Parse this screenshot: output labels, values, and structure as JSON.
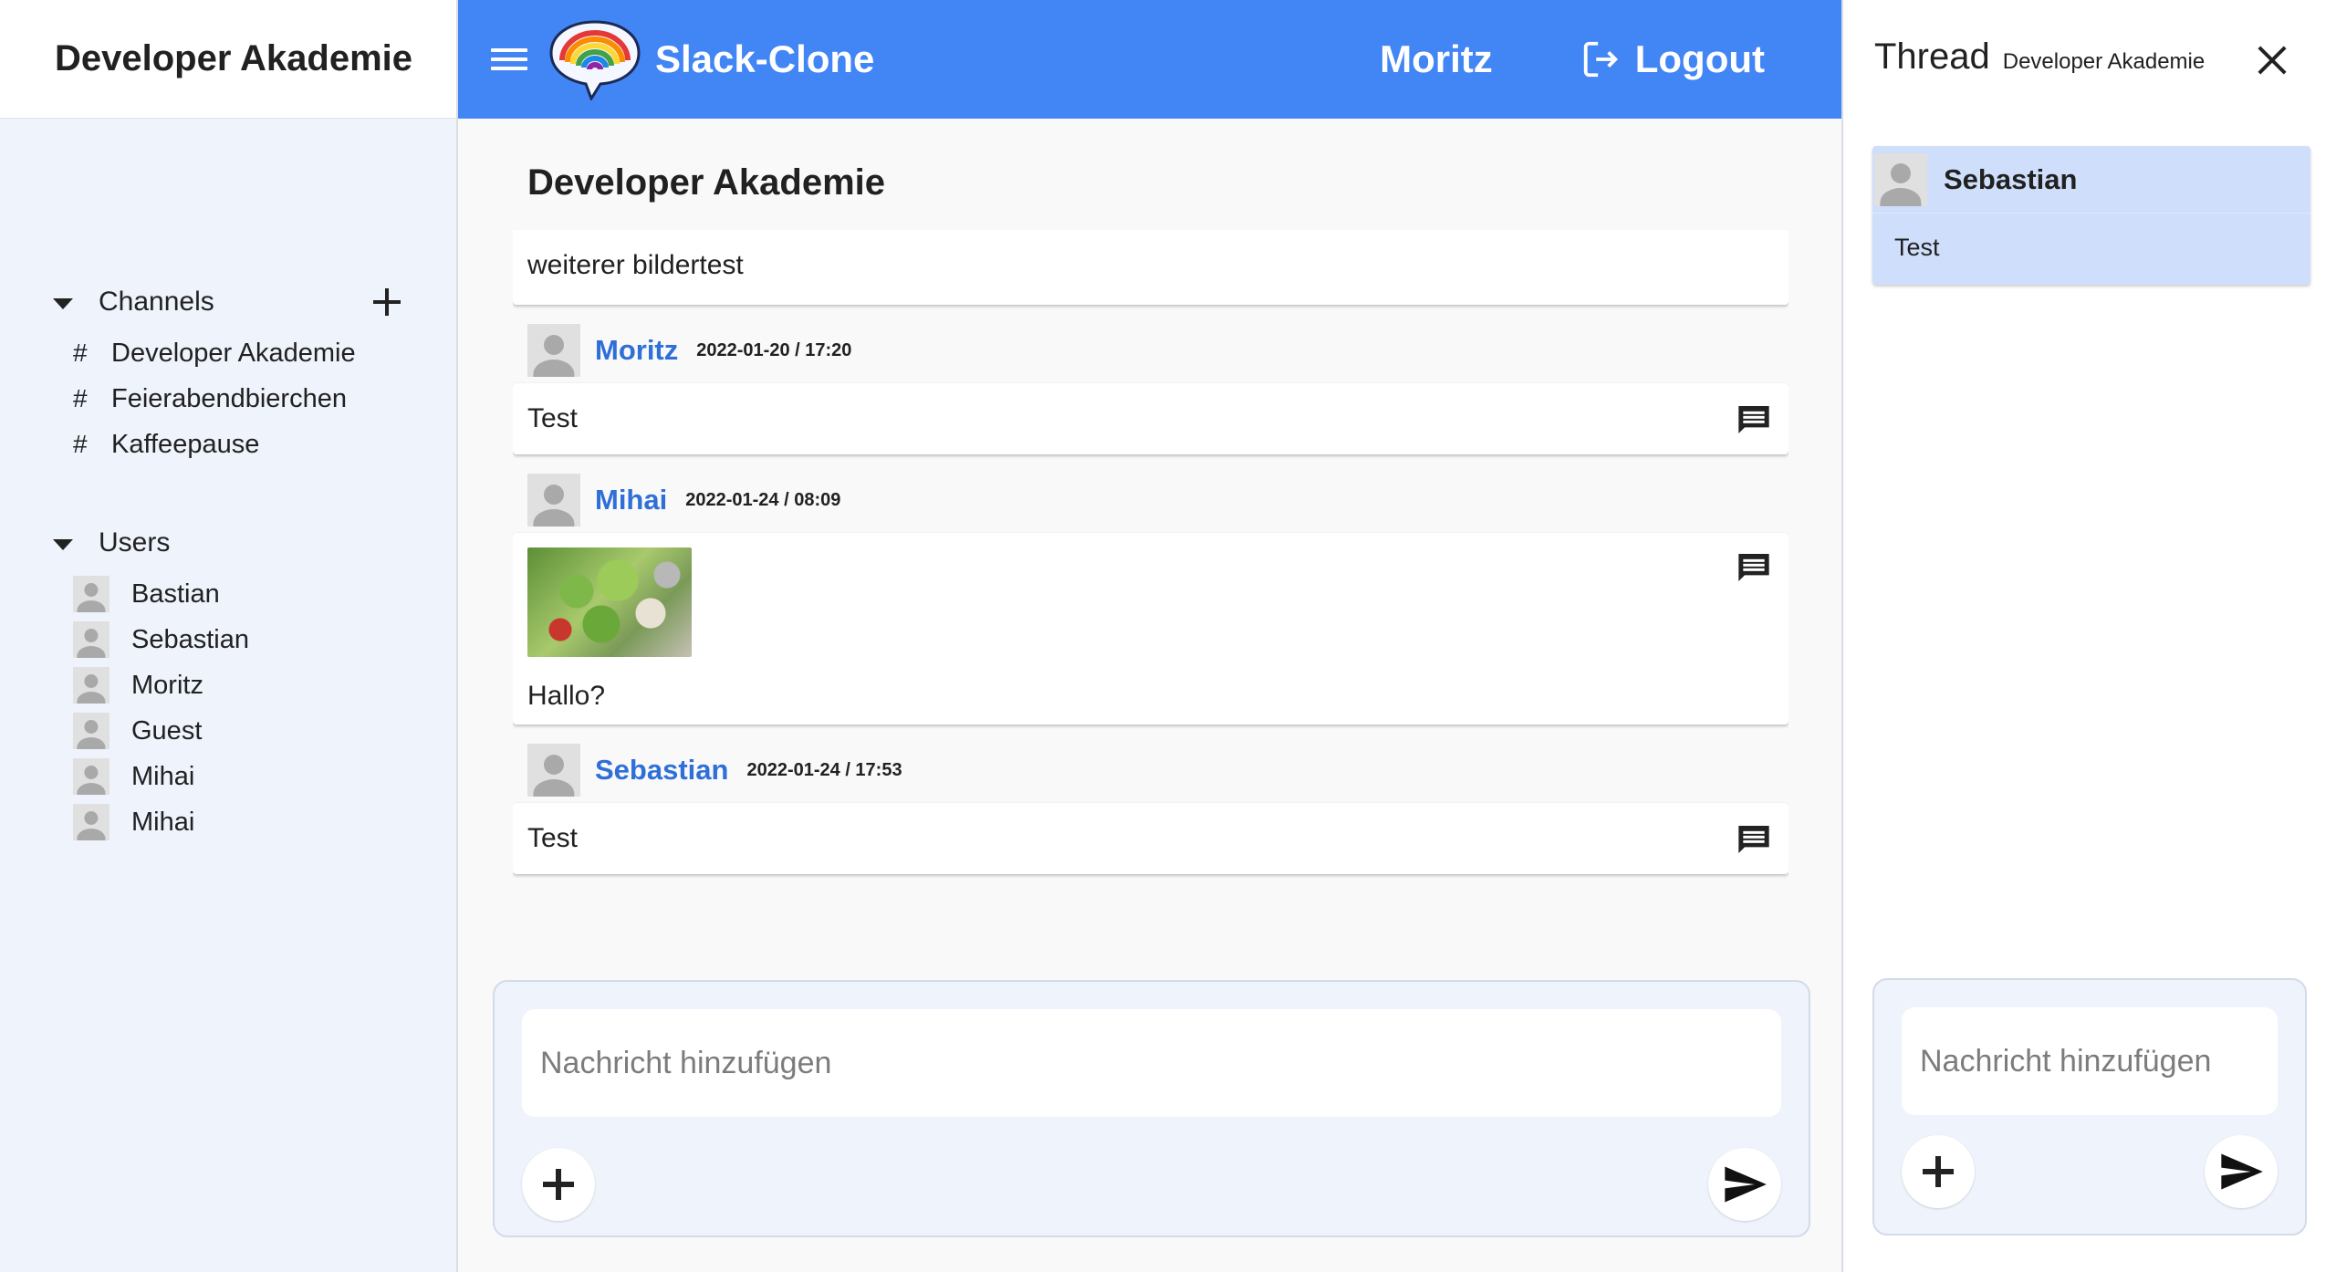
{
  "sidebar": {
    "workspace_title": "Developer Akademie",
    "channels_label": "Channels",
    "channels": [
      {
        "label": "Developer Akademie"
      },
      {
        "label": "Feierabendbierchen"
      },
      {
        "label": "Kaffeepause"
      }
    ],
    "users_label": "Users",
    "users": [
      {
        "name": "Bastian"
      },
      {
        "name": "Sebastian"
      },
      {
        "name": "Moritz"
      },
      {
        "name": "Guest"
      },
      {
        "name": "Mihai"
      },
      {
        "name": "Mihai"
      }
    ]
  },
  "topbar": {
    "app_title": "Slack-Clone",
    "current_user": "Moritz",
    "logout_label": "Logout",
    "accent_color": "#4285f4"
  },
  "main": {
    "channel_title": "Developer Akademie",
    "messages": [
      {
        "text": "weiterer bildertest"
      },
      {
        "author": "Moritz",
        "timestamp": "2022-01-20 / 17:20",
        "text": "Test"
      },
      {
        "author": "Mihai",
        "timestamp": "2022-01-24 / 08:09",
        "text": "Hallo?"
      },
      {
        "author": "Sebastian",
        "timestamp": "2022-01-24 / 17:53",
        "text": "Test"
      }
    ],
    "composer": {
      "placeholder": "Nachricht hinzufügen"
    }
  },
  "thread": {
    "title": "Thread",
    "channel": "Developer Akademie",
    "message": {
      "author": "Sebastian",
      "text": "Test"
    },
    "composer": {
      "placeholder": "Nachricht hinzufügen"
    }
  },
  "icons": {
    "menu": "menu-icon",
    "logo": "speech-bubble-rainbow-logo",
    "logout": "logout-icon",
    "comment": "comment-icon",
    "add": "plus-icon",
    "send": "send-icon",
    "close": "close-icon",
    "expand": "caret-down-icon"
  }
}
